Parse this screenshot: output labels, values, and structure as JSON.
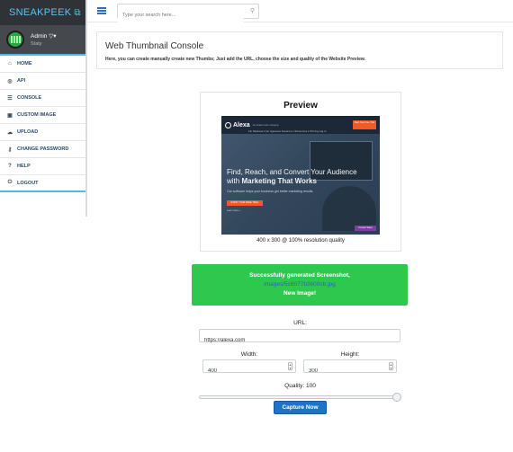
{
  "brand": {
    "name": "SNEAKPEEK",
    "icon": "external-link-icon"
  },
  "profile": {
    "name": "Admin",
    "role": "Staty"
  },
  "menu": [
    {
      "label": "HOME",
      "icon": "home-icon"
    },
    {
      "label": "API",
      "icon": "compass-icon"
    },
    {
      "label": "CONSOLE",
      "icon": "sliders-icon"
    },
    {
      "label": "CUSTOM IMAGE",
      "icon": "image-icon"
    },
    {
      "label": "UPLOAD",
      "icon": "cloud-upload-icon"
    },
    {
      "label": "CHANGE PASSWORD",
      "icon": "keys-icon"
    },
    {
      "label": "HELP",
      "icon": "question-icon"
    },
    {
      "label": "LOGOUT",
      "icon": "power-icon"
    }
  ],
  "search": {
    "placeholder": "Type your search here..."
  },
  "header": {
    "title": "Web Thumbnail Console",
    "subtitle": "Here, you can create manually create new Thumbs; Just add the URL, choose the size and quality of the Website Preview."
  },
  "preview": {
    "title": "Preview",
    "caption": "400 x 300 @ 100% resolution quality",
    "thumbnail": {
      "logo": "Alexa",
      "logo_sub": "An amazon.com company",
      "cta": "Start Your Free Trial",
      "nav": "For Marketers   For Agencies   Features ▾   Resources ▾   Pricing   Log in",
      "headline_1": "Find, Reach, and Convert Your Audience",
      "headline_2": "with",
      "headline_bold": "Marketing That Works",
      "body": "Our software helps your business get better marketing results.",
      "button": "START YOUR FREE TRIAL",
      "link": "Learn more »",
      "badge": "Contact Sales"
    }
  },
  "alert": {
    "line1": "Successfully generated Screenshot,",
    "link": "images/5c6077b3600cb.jpg",
    "line3": "New Image!",
    "color": "#2ec84f"
  },
  "form": {
    "url_label": "URL:",
    "url_value": "https://alexa.com",
    "width_label": "Width:",
    "width_value": "400",
    "height_label": "Height:",
    "height_value": "300",
    "quality_label": "Quality: 100",
    "quality_value": 100,
    "capture_label": "Capture Now"
  }
}
